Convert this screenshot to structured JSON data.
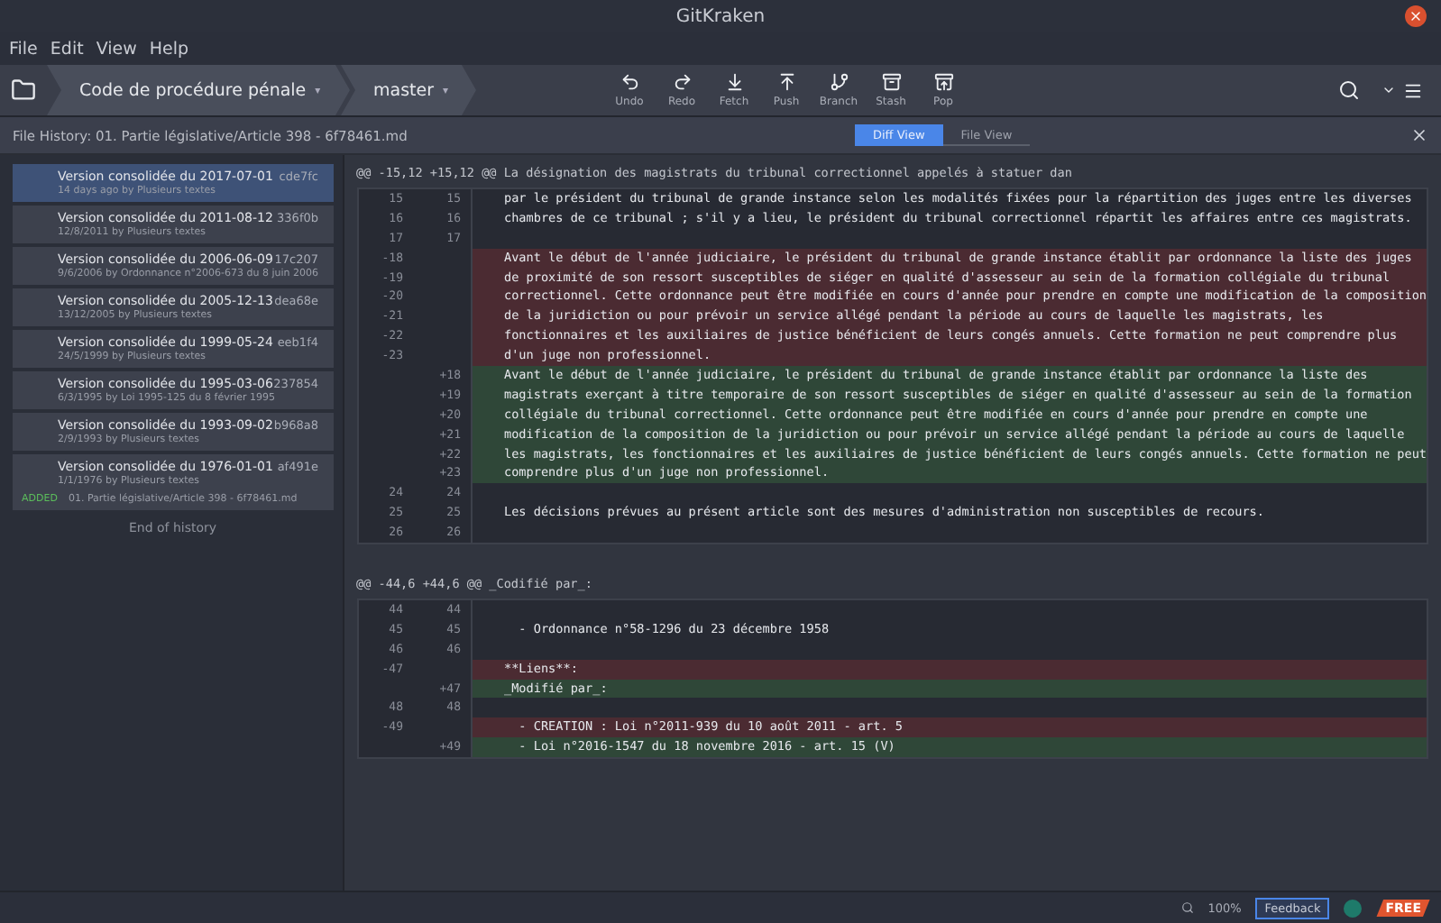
{
  "window": {
    "title": "GitKraken"
  },
  "menu": [
    "File",
    "Edit",
    "View",
    "Help"
  ],
  "breadcrumbs": [
    {
      "label": "Code de procédure pénale",
      "caret": "▾"
    },
    {
      "label": "master",
      "caret": "▾"
    }
  ],
  "toolbar": [
    {
      "kind": "undo",
      "label": "Undo"
    },
    {
      "kind": "redo",
      "label": "Redo"
    },
    {
      "kind": "fetch",
      "label": "Fetch"
    },
    {
      "kind": "push",
      "label": "Push"
    },
    {
      "kind": "branch",
      "label": "Branch"
    },
    {
      "kind": "stash",
      "label": "Stash"
    },
    {
      "kind": "pop",
      "label": "Pop"
    }
  ],
  "file_history": {
    "title": "File History: 01. Partie législative/Article 398 - 6f78461.md",
    "tabs": [
      {
        "label": "Diff View",
        "selected": true
      },
      {
        "label": "File View",
        "selected": false
      }
    ]
  },
  "commits": [
    {
      "title": "Version consolidée du 2017-07-01",
      "meta": "14 days ago by Plusieurs textes",
      "sha": "cde7fc",
      "selected": true
    },
    {
      "title": "Version consolidée du 2011-08-12",
      "meta": "12/8/2011 by Plusieurs textes",
      "sha": "336f0b",
      "selected": false
    },
    {
      "title": "Version consolidée du 2006-06-09",
      "meta": "9/6/2006 by Ordonnance n°2006-673 du 8 juin 2006",
      "sha": "17c207",
      "selected": false
    },
    {
      "title": "Version consolidée du 2005-12-13",
      "meta": "13/12/2005 by Plusieurs textes",
      "sha": "dea68e",
      "selected": false
    },
    {
      "title": "Version consolidée du 1999-05-24",
      "meta": "24/5/1999 by Plusieurs textes",
      "sha": "eeb1f4",
      "selected": false
    },
    {
      "title": "Version consolidée du 1995-03-06",
      "meta": "6/3/1995 by Loi 1995-125 du 8 février 1995",
      "sha": "237854",
      "selected": false
    },
    {
      "title": "Version consolidée du 1993-09-02",
      "meta": "2/9/1993 by Plusieurs textes",
      "sha": "b968a8",
      "selected": false
    },
    {
      "title": "Version consolidée du 1976-01-01",
      "meta": "1/1/1976 by Plusieurs textes",
      "sha": "af491e",
      "selected": false,
      "file": {
        "status": "ADDED",
        "path": "01. Partie législative/Article 398 - 6f78461.md"
      }
    }
  ],
  "end_label": "End of history",
  "hunks": [
    {
      "header": "@@ -15,12 +15,12 @@ La désignation des magistrats du tribunal correctionnel appelés à statuer dan",
      "lines": [
        {
          "kind": "context",
          "old": "15",
          "new": "15",
          "text": "par le président du tribunal de grande instance selon les modalités fixées pour la répartition des juges entre les diverses"
        },
        {
          "kind": "context",
          "old": "16",
          "new": "16",
          "text": "chambres de ce tribunal ; s'il y a lieu, le président du tribunal correctionnel répartit les affaires entre ces magistrats."
        },
        {
          "kind": "context",
          "old": "17",
          "new": "17"
        },
        {
          "kind": "del",
          "old": "-18",
          "text": "Avant le début de l'année judiciaire, le président du tribunal de grande instance établit par ordonnance la liste des juges"
        },
        {
          "kind": "del",
          "old": "-19",
          "text": "de proximité de son ressort susceptibles de siéger en qualité d'assesseur au sein de la formation collégiale du tribunal"
        },
        {
          "kind": "del",
          "old": "-20",
          "text": "correctionnel. Cette ordonnance peut être modifiée en cours d'année pour prendre en compte une modification de la composition"
        },
        {
          "kind": "del",
          "old": "-21",
          "text": "de la juridiction ou pour prévoir un service allégé pendant la période au cours de laquelle les magistrats, les"
        },
        {
          "kind": "del",
          "old": "-22",
          "text": "fonctionnaires et les auxiliaires de justice bénéficient de leurs congés annuels. Cette formation ne peut comprendre plus"
        },
        {
          "kind": "del",
          "old": "-23",
          "text": "d'un juge non professionnel."
        },
        {
          "kind": "add",
          "new": "+18",
          "text": "Avant le début de l'année judiciaire, le président du tribunal de grande instance établit par ordonnance la liste des"
        },
        {
          "kind": "add",
          "new": "+19",
          "text": "magistrats exerçant à titre temporaire de son ressort susceptibles de siéger en qualité d'assesseur au sein de la formation"
        },
        {
          "kind": "add",
          "new": "+20",
          "text": "collégiale du tribunal correctionnel. Cette ordonnance peut être modifiée en cours d'année pour prendre en compte une"
        },
        {
          "kind": "add",
          "new": "+21",
          "text": "modification de la composition de la juridiction ou pour prévoir un service allégé pendant la période au cours de laquelle"
        },
        {
          "kind": "add",
          "new": "+22",
          "text": "les magistrats, les fonctionnaires et les auxiliaires de justice bénéficient de leurs congés annuels. Cette formation ne peut"
        },
        {
          "kind": "add",
          "new": "+23",
          "text": "comprendre plus d'un juge non professionnel."
        },
        {
          "kind": "context",
          "old": "24",
          "new": "24"
        },
        {
          "kind": "context",
          "old": "25",
          "new": "25",
          "text": "Les décisions prévues au présent article sont des mesures d'administration non susceptibles de recours."
        },
        {
          "kind": "context",
          "old": "26",
          "new": "26"
        }
      ]
    },
    {
      "header": "@@ -44,6 +44,6 @@ _Codifié par_:",
      "lines": [
        {
          "kind": "context",
          "old": "44",
          "new": "44"
        },
        {
          "kind": "context",
          "old": "45",
          "new": "45",
          "text": "  - Ordonnance n°58-1296 du 23 décembre 1958"
        },
        {
          "kind": "context",
          "old": "46",
          "new": "46"
        },
        {
          "kind": "del",
          "old": "-47",
          "text": "**Liens**:"
        },
        {
          "kind": "add",
          "new": "+47",
          "text": "_Modifié par_:"
        },
        {
          "kind": "context",
          "old": "48",
          "new": "48"
        },
        {
          "kind": "del",
          "old": "-49",
          "text": "  - CREATION : Loi n°2011-939 du 10 août 2011 - art. 5"
        },
        {
          "kind": "add",
          "new": "+49",
          "text": "  - Loi n°2016-1547 du 18 novembre 2016 - art. 15 (V)"
        }
      ]
    }
  ],
  "status_bar": {
    "zoom": "100%",
    "feedback": "Feedback",
    "badge": "FREE"
  }
}
